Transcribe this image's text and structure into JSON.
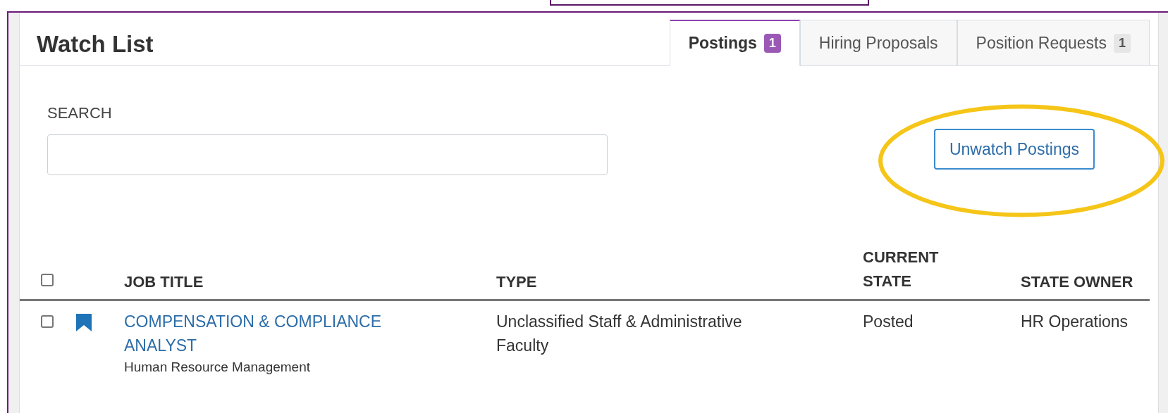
{
  "title": "Watch List",
  "tabs": [
    {
      "label": "Postings",
      "badge": "1",
      "selected": true
    },
    {
      "label": "Hiring Proposals",
      "selected": false
    },
    {
      "label": "Position Requests",
      "badge": "1",
      "selected": false
    }
  ],
  "search": {
    "label": "SEARCH"
  },
  "action_button": {
    "label": "Unwatch Postings",
    "highlighted": true
  },
  "table": {
    "columns": [
      "JOB TITLE",
      "TYPE",
      "CURRENT STATE",
      "STATE OWNER"
    ],
    "header_checked": false,
    "rows": [
      {
        "checked": false,
        "watched": true,
        "job_title": "COMPENSATION & COMPLIANCE ANALYST",
        "department": "Human Resource Management",
        "type": "Unclassified Staff & Administrative Faculty",
        "current_state": "Posted",
        "state_owner": "HR Operations"
      }
    ]
  }
}
